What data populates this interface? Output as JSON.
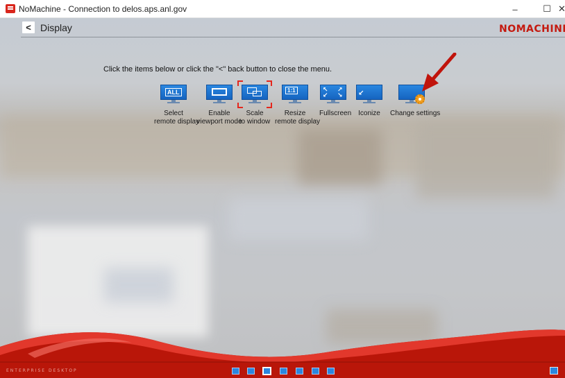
{
  "window": {
    "title": "NoMachine - Connection to delos.aps.anl.gov",
    "minimize_label": "–",
    "maximize_label": "☐",
    "close_label": "✕"
  },
  "header": {
    "back_label": "<",
    "title": "Display",
    "logo": "NOMACHINE"
  },
  "instruction": "Click the items below or click the \"<\" back button to close the menu.",
  "items": [
    {
      "line1": "Select",
      "line2": "remote display",
      "glyph": "ALL"
    },
    {
      "line1": "Enable",
      "line2": "viewport mode",
      "glyph": ""
    },
    {
      "line1": "Scale",
      "line2": "to window",
      "glyph": ""
    },
    {
      "line1": "Resize",
      "line2": "remote display",
      "glyph": "1:1"
    },
    {
      "line1": "Fullscreen",
      "line2": "",
      "glyph": ""
    },
    {
      "line1": "Iconize",
      "line2": "",
      "glyph": ""
    },
    {
      "line1": "Change settings",
      "line2": "",
      "glyph": ""
    }
  ],
  "footer": {
    "brand": "ENTERPRISE DESKTOP"
  },
  "colors": {
    "accent_red": "#c41a10",
    "icon_blue": "#1f74d0",
    "arrow_red": "#c0140c"
  }
}
